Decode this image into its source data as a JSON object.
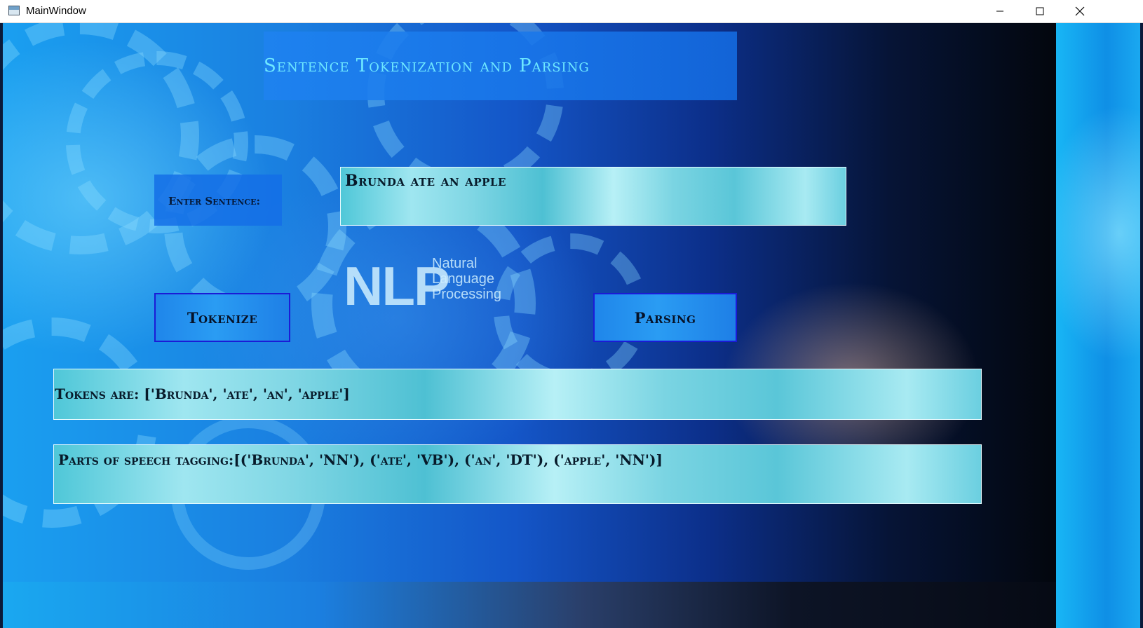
{
  "window": {
    "title": "MainWindow",
    "controls": {
      "minimize": "minimize-icon",
      "maximize": "maximize-icon",
      "close": "close-icon"
    }
  },
  "background": {
    "logo_big": "NLP",
    "logo_sub_lines": [
      "Natural",
      "Language",
      "Processing"
    ]
  },
  "header": {
    "title": "Sentence Tokenization and Parsing"
  },
  "form": {
    "sentence_label": "Enter Sentence:",
    "sentence_value": "Brunda ate an apple"
  },
  "buttons": {
    "tokenize": "Tokenize",
    "parsing": "Parsing"
  },
  "results": {
    "tokens": "Tokens are: ['Brunda', 'ate', 'an', 'apple']",
    "pos_tagging": "Parts of speech tagging:[('Brunda', 'NN'), ('ate', 'VB'), ('an', 'DT'), ('apple', 'NN')]"
  },
  "colors": {
    "title_text": "#6ee8ff",
    "button_border": "#1b1bd6",
    "button_fill": "#2a9cf3"
  }
}
